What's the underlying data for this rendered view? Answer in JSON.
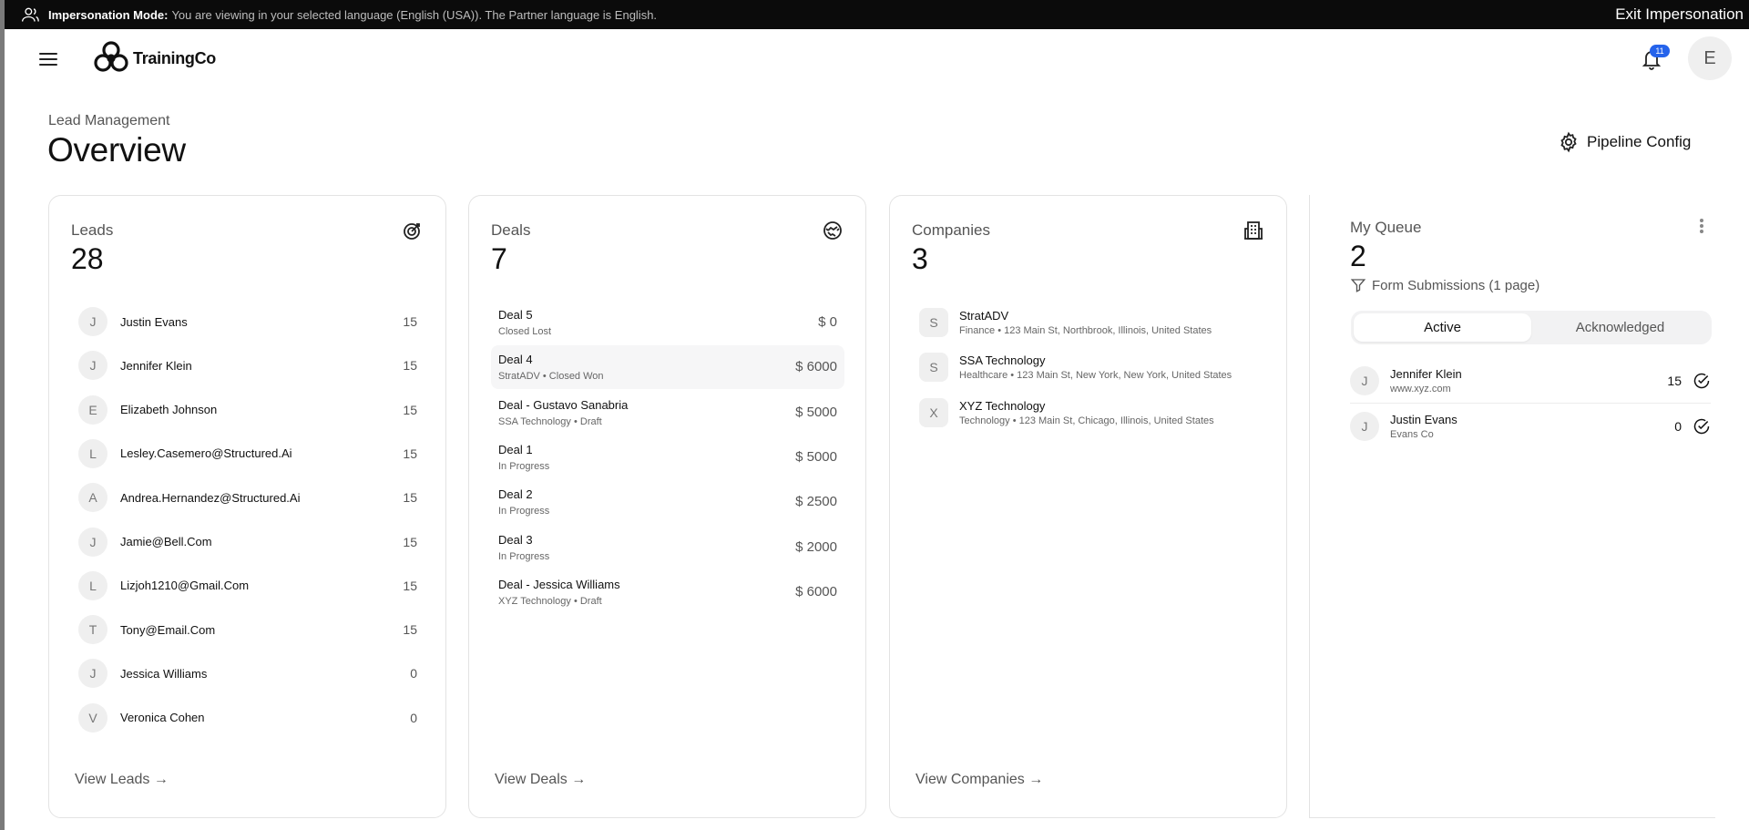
{
  "impersonation": {
    "label": "Impersonation Mode:",
    "message": "You are viewing in your selected language (English (USA)). The Partner language is English.",
    "exit_label": "Exit Impersonation"
  },
  "header": {
    "brand": "TrainingCo",
    "notification_count": "11",
    "avatar_initial": "E"
  },
  "page": {
    "breadcrumb": "Lead Management",
    "title": "Overview",
    "pipeline_config_label": "Pipeline Config"
  },
  "leads": {
    "title": "Leads",
    "count": "28",
    "footer": "View Leads →",
    "items": [
      {
        "initial": "J",
        "name": "Justin Evans",
        "score": "15"
      },
      {
        "initial": "J",
        "name": "Jennifer Klein",
        "score": "15"
      },
      {
        "initial": "E",
        "name": "Elizabeth Johnson",
        "score": "15"
      },
      {
        "initial": "L",
        "name": "Lesley.Casemero@Structured.Ai",
        "score": "15"
      },
      {
        "initial": "A",
        "name": "Andrea.Hernandez@Structured.Ai",
        "score": "15"
      },
      {
        "initial": "J",
        "name": "Jamie@Bell.Com",
        "score": "15"
      },
      {
        "initial": "L",
        "name": "Lizjoh1210@Gmail.Com",
        "score": "15"
      },
      {
        "initial": "T",
        "name": "Tony@Email.Com",
        "score": "15"
      },
      {
        "initial": "J",
        "name": "Jessica Williams",
        "score": "0"
      },
      {
        "initial": "V",
        "name": "Veronica Cohen",
        "score": "0"
      }
    ]
  },
  "deals": {
    "title": "Deals",
    "count": "7",
    "footer": "View Deals →",
    "items": [
      {
        "name": "Deal 5",
        "sub": "Closed Lost",
        "amount": "$ 0"
      },
      {
        "name": "Deal 4",
        "sub": "StratADV • Closed Won",
        "amount": "$ 6000"
      },
      {
        "name": "Deal - Gustavo Sanabria",
        "sub": "SSA Technology • Draft",
        "amount": "$ 5000"
      },
      {
        "name": "Deal 1",
        "sub": "In Progress",
        "amount": "$ 5000"
      },
      {
        "name": "Deal 2",
        "sub": "In Progress",
        "amount": "$ 2500"
      },
      {
        "name": "Deal 3",
        "sub": "In Progress",
        "amount": "$ 2000"
      },
      {
        "name": "Deal - Jessica Williams",
        "sub": "XYZ Technology • Draft",
        "amount": "$ 6000"
      }
    ]
  },
  "companies": {
    "title": "Companies",
    "count": "3",
    "footer": "View Companies →",
    "items": [
      {
        "initial": "S",
        "name": "StratADV",
        "sub": "Finance • 123 Main St, Northbrook, Illinois, United States"
      },
      {
        "initial": "S",
        "name": "SSA Technology",
        "sub": "Healthcare • 123 Main St, New York, New York, United States"
      },
      {
        "initial": "X",
        "name": "XYZ Technology",
        "sub": "Technology • 123 Main St, Chicago, Illinois, United States"
      }
    ]
  },
  "queue": {
    "title": "My Queue",
    "count": "2",
    "filter": "Form Submissions (1 page)",
    "tabs": [
      "Active",
      "Acknowledged"
    ],
    "items": [
      {
        "initial": "J",
        "name": "Jennifer Klein",
        "sub": "www.xyz.com",
        "score": "15"
      },
      {
        "initial": "J",
        "name": "Justin Evans",
        "sub": "Evans Co",
        "score": "0"
      }
    ]
  }
}
